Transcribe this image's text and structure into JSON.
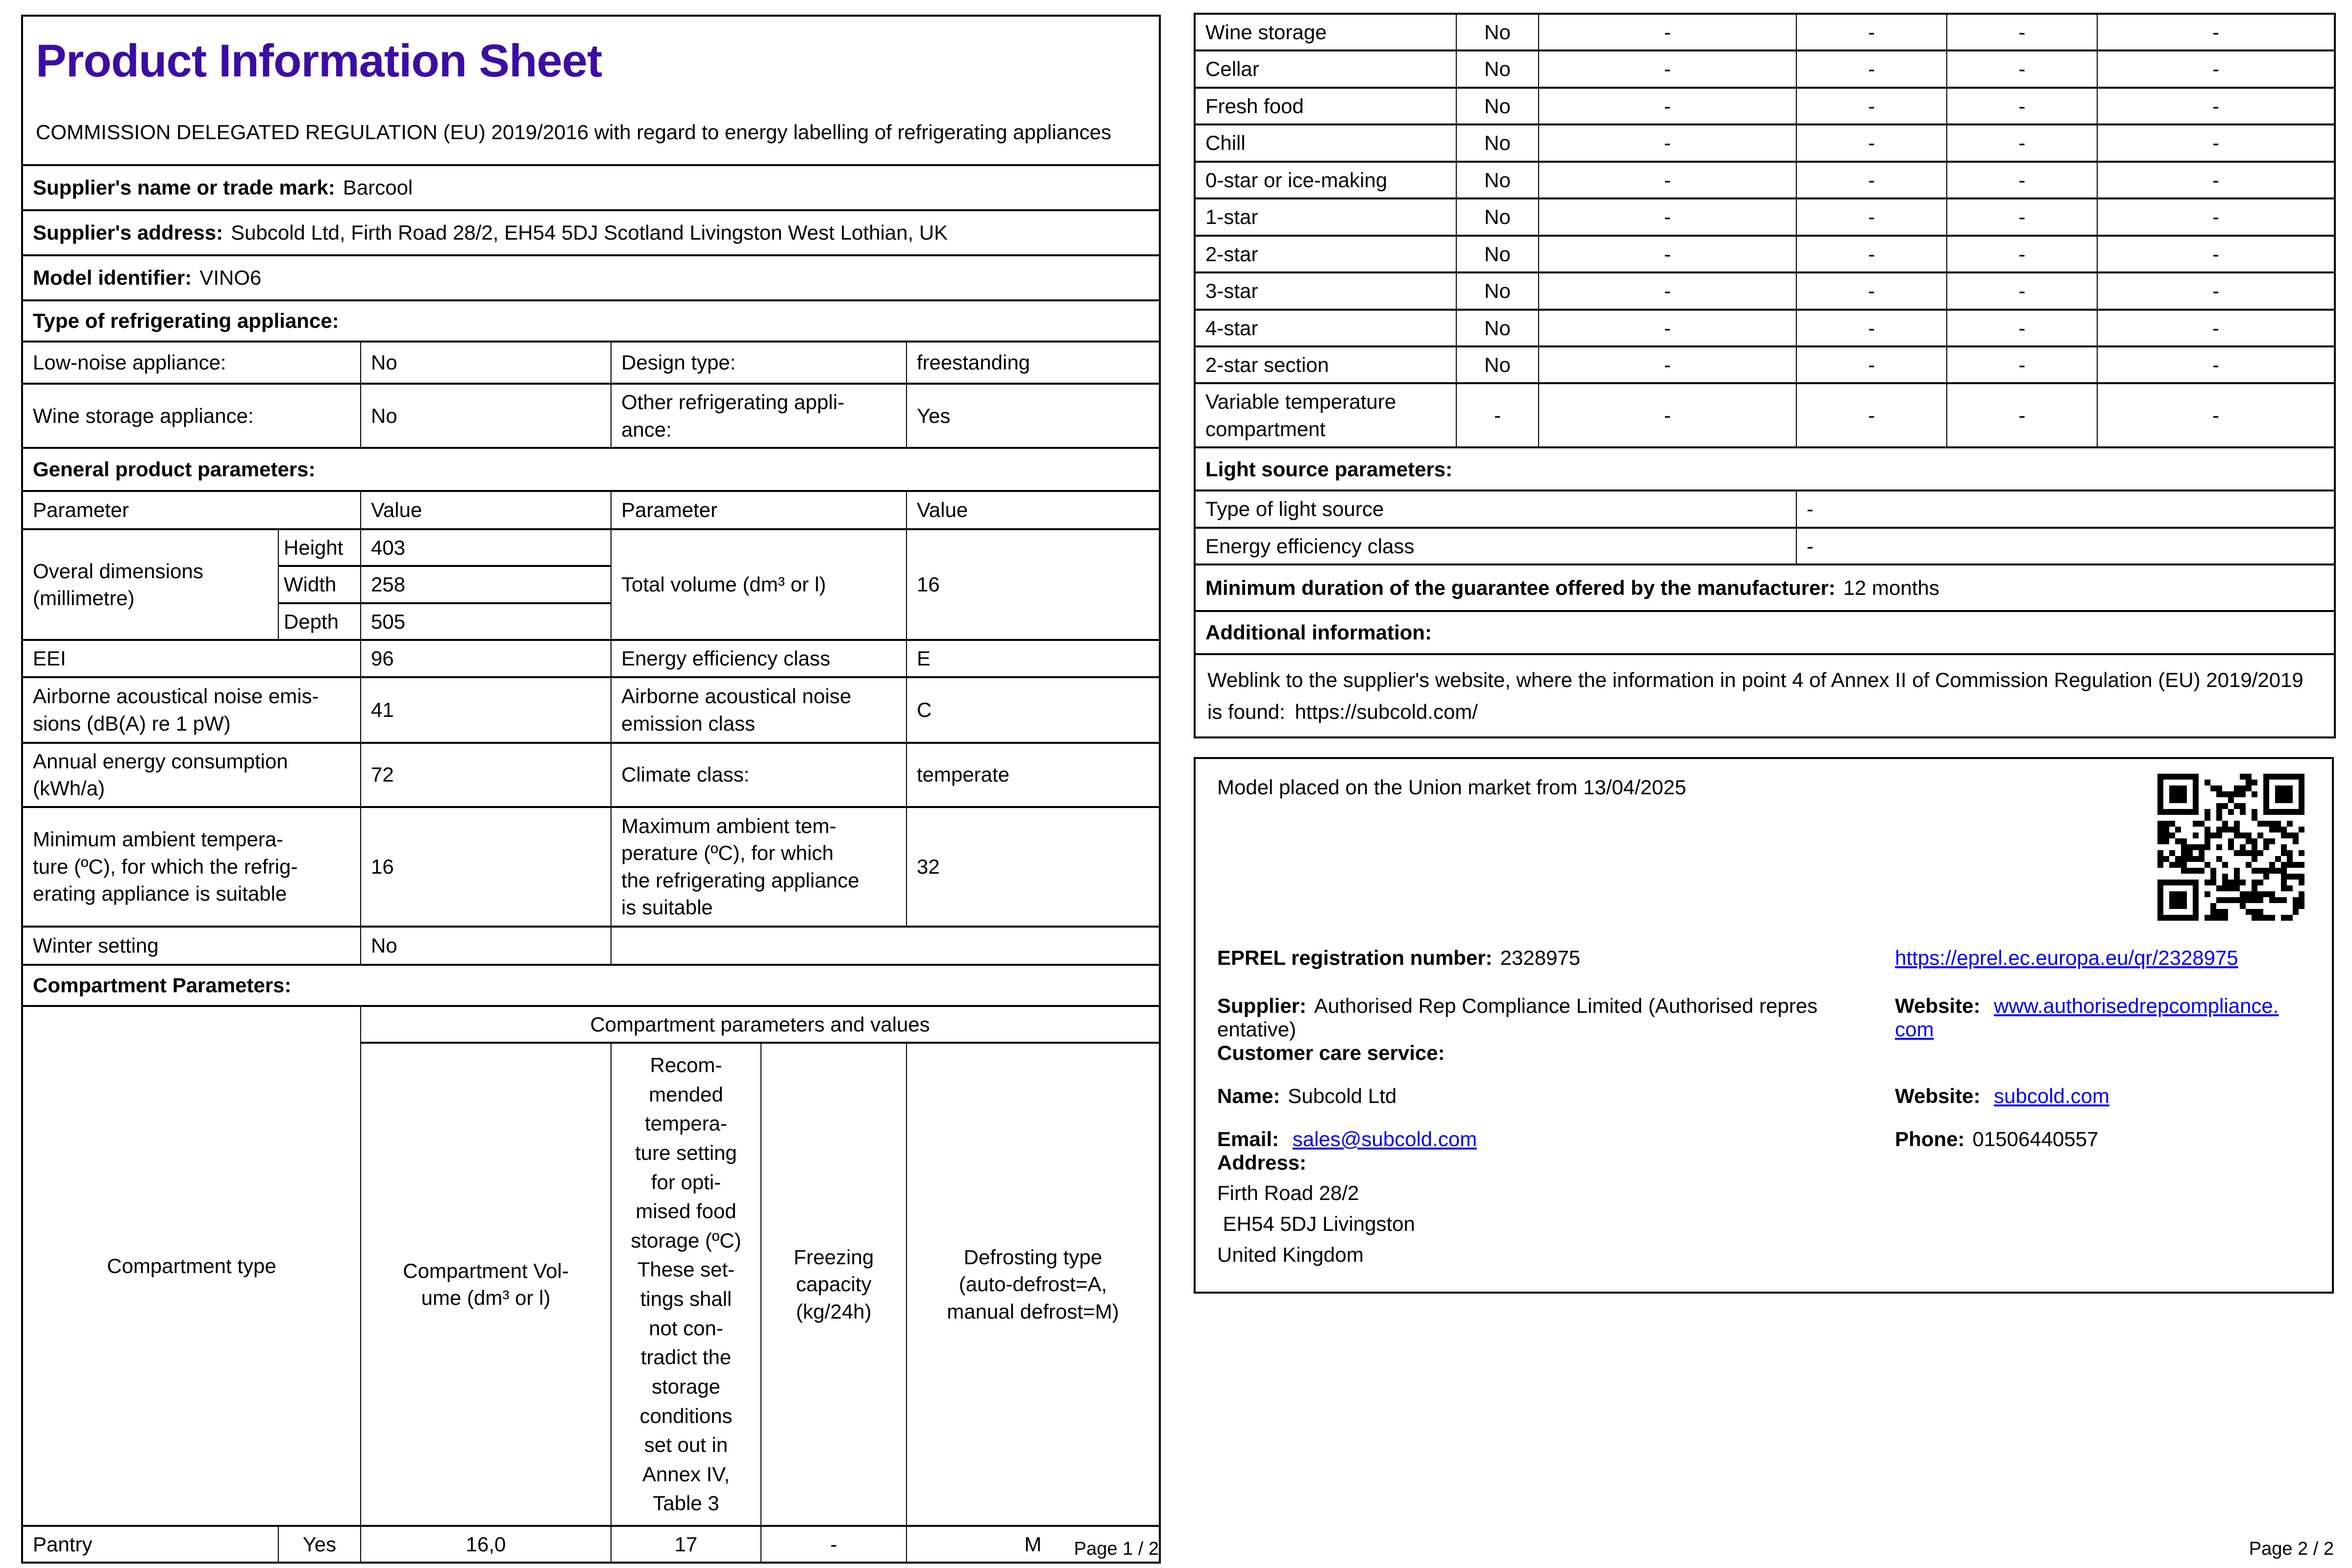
{
  "colors": {
    "title": "#3b0da5",
    "link": "#0000ee",
    "text": "#000000",
    "border": "#000000"
  },
  "page1": {
    "title": "Product Information Sheet",
    "regulation": "COMMISSION DELEGATED REGULATION (EU) 2019/2016 with regard to energy labelling of refrigerating appliances",
    "supplier_name": {
      "label": "Supplier's name or trade mark:",
      "value": "Barcool"
    },
    "supplier_address": {
      "label": "Supplier's address:",
      "value": "Subcold Ltd, Firth Road 28/2, EH54 5DJ Scotland Livingston West Lothian, UK"
    },
    "model_identifier": {
      "label": "Model identifier:",
      "value": "VINO6"
    },
    "type_heading": "Type of refrigerating appliance:",
    "low_noise": {
      "label": "Low-noise appliance:",
      "value": "No"
    },
    "design_type": {
      "label": "Design type:",
      "value": "freestanding"
    },
    "wine_storage_appliance": {
      "label": "Wine storage appliance:",
      "value": "No"
    },
    "other_appliance": {
      "label": "Other refrigerating appli-\nance:",
      "value": "Yes"
    },
    "general_heading": "General product parameters:",
    "param_header": {
      "parameter": "Parameter",
      "value": "Value"
    },
    "dimensions": {
      "label": "Overal dimensions\n(millimetre)",
      "height_label": "Height",
      "height": "403",
      "width_label": "Width",
      "width": "258",
      "depth_label": "Depth",
      "depth": "505"
    },
    "total_volume": {
      "label": "Total volume (dm³ or l)",
      "value": "16"
    },
    "eei": {
      "label": "EEI",
      "value": "96"
    },
    "energy_class": {
      "label": "Energy efficiency class",
      "value": "E"
    },
    "noise": {
      "label": "Airborne acoustical noise emis-\nsions (dB(A) re 1 pW)",
      "value": "41"
    },
    "noise_class": {
      "label": "Airborne acoustical noise\nemission class",
      "value": "C"
    },
    "annual_energy": {
      "label": "Annual energy consumption\n(kWh/a)",
      "value": "72"
    },
    "climate_class": {
      "label": "Climate class:",
      "value": "temperate"
    },
    "min_ambient": {
      "label": "Minimum ambient tempera-\nture (ºC), for which the refrig-\nerating appliance is suitable",
      "value": "16"
    },
    "max_ambient": {
      "label": "Maximum ambient tem-\nperature (ºC), for which\nthe refrigerating appliance\nis suitable",
      "value": "32"
    },
    "winter_setting": {
      "label": "Winter setting",
      "value": "No"
    },
    "compartment_heading": "Compartment Parameters:",
    "compartment_table": {
      "span_header": "Compartment parameters and values",
      "col_type": "Compartment type",
      "col_volume": "Compartment Vol-\nume (dm³ or l)",
      "col_temp": "Recom-\nmended\ntempera-\nture setting\nfor opti-\nmised food\nstorage (ºC)\nThese set-\ntings shall\nnot con-\ntradict the\nstorage\nconditions\nset out in\nAnnex IV,\nTable 3",
      "col_freezing": "Freezing\ncapacity\n(kg/24h)",
      "col_defrost": "Defrosting type\n(auto-defrost=A,\nmanual defrost=M)",
      "row": [
        "Pantry",
        "Yes",
        "16,0",
        "17",
        "-",
        "M"
      ]
    },
    "footer": "Page 1 / 2"
  },
  "page2": {
    "compartments": {
      "rows": [
        [
          "Wine storage",
          "No",
          "-",
          "-",
          "-",
          "-"
        ],
        [
          "Cellar",
          "No",
          "-",
          "-",
          "-",
          "-"
        ],
        [
          "Fresh food",
          "No",
          "-",
          "-",
          "-",
          "-"
        ],
        [
          "Chill",
          "No",
          "-",
          "-",
          "-",
          "-"
        ],
        [
          "0-star or ice-making",
          "No",
          "-",
          "-",
          "-",
          "-"
        ],
        [
          "1-star",
          "No",
          "-",
          "-",
          "-",
          "-"
        ],
        [
          "2-star",
          "No",
          "-",
          "-",
          "-",
          "-"
        ],
        [
          "3-star",
          "No",
          "-",
          "-",
          "-",
          "-"
        ],
        [
          "4-star",
          "No",
          "-",
          "-",
          "-",
          "-"
        ],
        [
          "2-star section",
          "No",
          "-",
          "-",
          "-",
          "-"
        ],
        [
          "Variable temperature\ncompartment",
          "-",
          "-",
          "-",
          "-",
          "-"
        ]
      ]
    },
    "light_heading": "Light source parameters:",
    "light_type": {
      "label": "Type of light source",
      "value": "-"
    },
    "light_class": {
      "label": "Energy efficiency class",
      "value": "-"
    },
    "guarantee": {
      "label": "Minimum duration of the guarantee offered by the manufacturer:",
      "value": "12 months"
    },
    "additional_heading": "Additional information:",
    "weblink": {
      "label": "Weblink to the supplier's website, where the information in point 4 of Annex II of Commission Regulation (EU) 2019/2019 is found:",
      "value": "https://subcold.com/"
    },
    "market": "Model placed on the Union market from 13/04/2025",
    "qr_icon": "eprel-qr-code",
    "eprel": {
      "label": "EPREL registration number:",
      "value": "2328975",
      "link": "https://eprel.ec.europa.eu/qr/2328975"
    },
    "supplier": {
      "label": "Supplier:",
      "value": "Authorised Rep Compliance Limited (Authorised repres\nentative)",
      "website_label": "Website:",
      "website": "www.authorisedrepcompliance.\ncom"
    },
    "care_heading": "Customer care service:",
    "care_name": {
      "label": "Name:",
      "value": "Subcold Ltd"
    },
    "care_website": {
      "label": "Website:",
      "value": "subcold.com"
    },
    "care_email": {
      "label": "Email:",
      "value": "sales@subcold.com"
    },
    "care_phone": {
      "label": "Phone:",
      "value": "01506440557"
    },
    "address": {
      "label": "Address:",
      "lines": "Firth Road 28/2\n EH54 5DJ Livingston\nUnited Kingdom"
    },
    "footer": "Page 2 / 2"
  }
}
